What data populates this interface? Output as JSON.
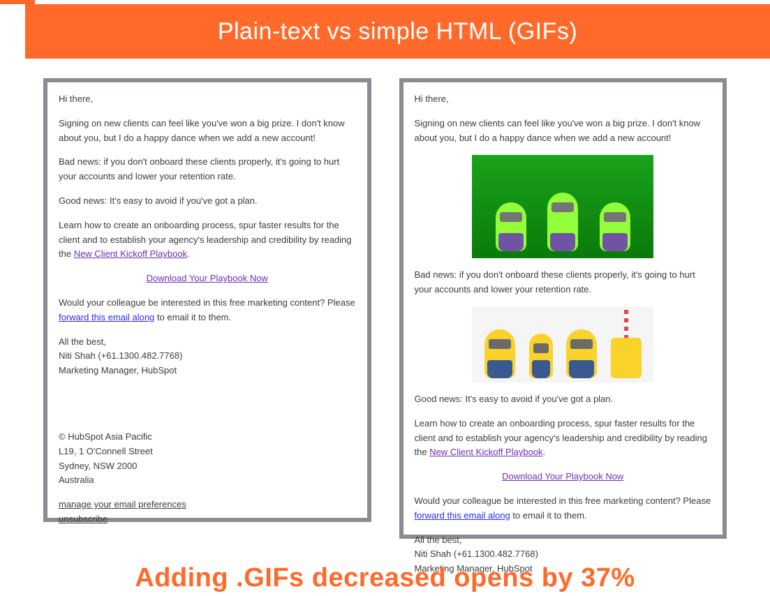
{
  "header": {
    "title": "Plain-text vs simple HTML (GIFs)"
  },
  "email": {
    "greeting": "Hi there,",
    "p1": "Signing on new clients can feel like you've won a big prize. I don't know about you, but I do a happy dance when we add a new account!",
    "p2": "Bad news: if you don't onboard these clients properly, it's going to hurt your accounts and lower your retention rate.",
    "p3": "Good news: It's easy to avoid if you've got a plan.",
    "p4_a": "Learn how to create an onboarding process, spur faster results for the client and to establish your agency's leadership and credibility by reading the ",
    "p4_link": "New Client Kickoff Playbook",
    "p4_b": ".",
    "download": "Download Your Playbook Now",
    "p5_a": "Would your colleague be interested in this free marketing content? Please ",
    "p5_link": "forward this email along",
    "p5_b": " to email it to them.",
    "sig1": "All the best,",
    "sig2": "Niti Shah (+61.1300.482.7768)",
    "sig3": "Marketing Manager, HubSpot",
    "footer1": "© HubSpot Asia Pacific",
    "footer2": "L19, 1 O'Connell Street",
    "footer3": "Sydney, NSW 2000",
    "footer4": "Australia",
    "manage_prefs": "manage your email preferences",
    "unsubscribe": "unsubscribe"
  },
  "caption": "Adding .GIFs decreased opens by 37%",
  "chart_data": {
    "type": "table",
    "title": "Plain-text vs simple HTML (GIFs)",
    "metric": "email opens",
    "effect_of_adding_gifs_pct_change": -37
  }
}
